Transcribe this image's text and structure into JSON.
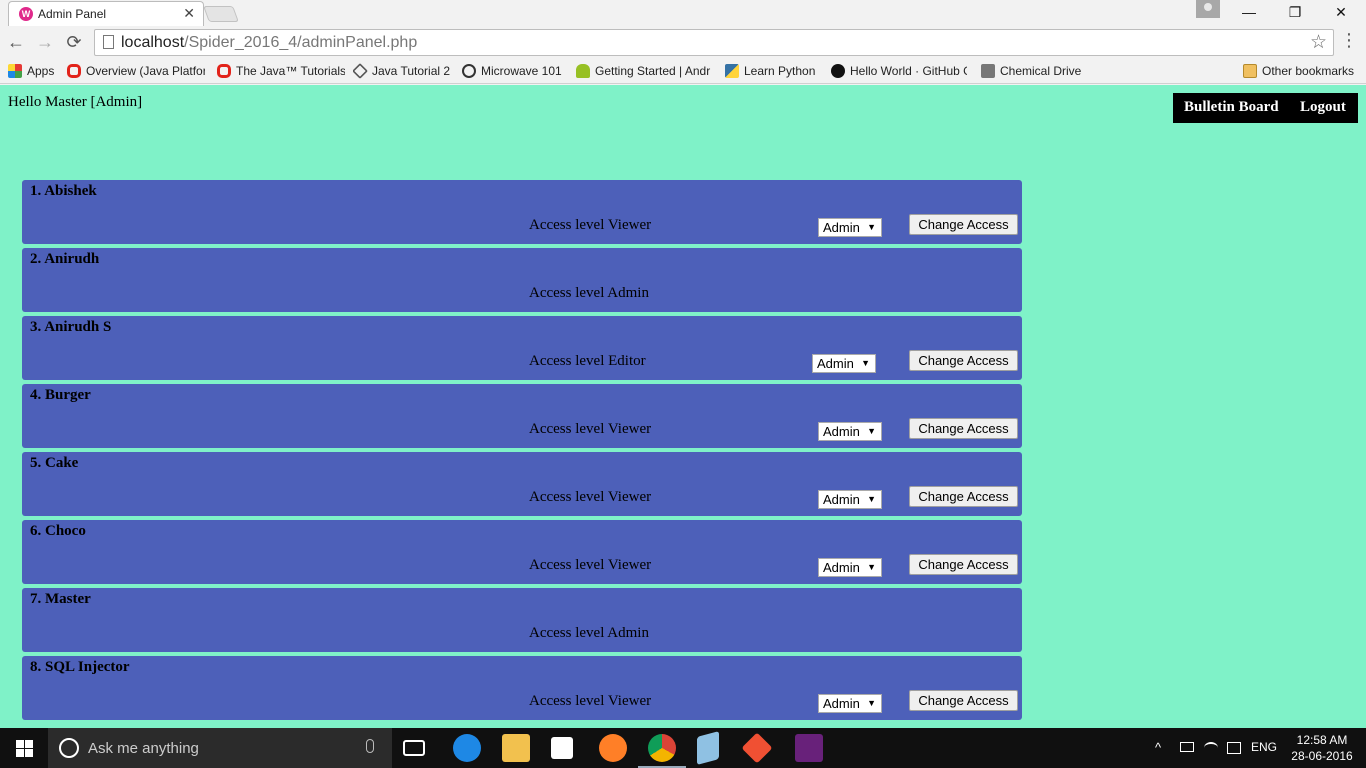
{
  "browser": {
    "tab": {
      "favicon": "W",
      "title": "Admin Panel",
      "close": "✕"
    },
    "window_buttons": {
      "minimize": "—",
      "restore": "❐",
      "close": "✕"
    },
    "nav": {
      "back": "←",
      "forward": "→",
      "reload": "⟳"
    },
    "url": {
      "host": "localhost",
      "path": "/Spider_2016_4/adminPanel.php"
    },
    "star": "☆",
    "menu": "⋮",
    "bookmarks": [
      {
        "label": "Apps",
        "icon": "apps-grid-icon",
        "color": "#e53935"
      },
      {
        "label": "Overview (Java Platfor",
        "icon": "oracle-icon",
        "color": "#e2231a"
      },
      {
        "label": "The Java™ Tutorials",
        "icon": "oracle-icon",
        "color": "#e2231a"
      },
      {
        "label": "Java Tutorial 2",
        "icon": "diamond-icon",
        "color": "#555555"
      },
      {
        "label": "Microwave 101",
        "icon": "globe-icon",
        "color": "#333333"
      },
      {
        "label": "Getting Started | Andr",
        "icon": "android-icon",
        "color": "#97c024"
      },
      {
        "label": "Learn Python",
        "icon": "python-icon",
        "color": "#3572a5"
      },
      {
        "label": "Hello World · GitHub G",
        "icon": "github-icon",
        "color": "#111111"
      },
      {
        "label": "Chemical Drive",
        "icon": "drive-icon",
        "color": "#777777"
      }
    ],
    "other_bookmarks": "Other bookmarks"
  },
  "page": {
    "greeting": "Hello Master [Admin]",
    "nav": {
      "bulletin": "Bulletin Board",
      "logout": "Logout"
    },
    "change_access_label": "Change Access",
    "users": [
      {
        "num": "1.",
        "name": "Abishek",
        "access": "Access level Viewer",
        "select": "Admin",
        "editable": true
      },
      {
        "num": "2.",
        "name": "Anirudh",
        "access": "Access level Admin",
        "select": "",
        "editable": false
      },
      {
        "num": "3.",
        "name": "Anirudh S",
        "access": "Access level Editor",
        "select": "Admin",
        "editable": true
      },
      {
        "num": "4.",
        "name": "Burger",
        "access": "Access level Viewer",
        "select": "Admin",
        "editable": true
      },
      {
        "num": "5.",
        "name": "Cake",
        "access": "Access level Viewer",
        "select": "Admin",
        "editable": true
      },
      {
        "num": "6.",
        "name": "Choco",
        "access": "Access level Viewer",
        "select": "Admin",
        "editable": true
      },
      {
        "num": "7.",
        "name": "Master",
        "access": "Access level Admin",
        "select": "",
        "editable": false
      },
      {
        "num": "8.",
        "name": "SQL Injector",
        "access": "Access level Viewer",
        "select": "Admin",
        "editable": true
      }
    ]
  },
  "taskbar": {
    "search_placeholder": "Ask me anything",
    "language": "ENG",
    "time": "12:58 AM",
    "date": "28-06-2016",
    "pinned": [
      {
        "name": "task-view-icon",
        "color": "#ffffff"
      },
      {
        "name": "edge-icon",
        "color": "#1e88e5"
      },
      {
        "name": "file-explorer-icon",
        "color": "#f2c14e"
      },
      {
        "name": "store-icon",
        "color": "#ffffff"
      },
      {
        "name": "firefox-icon",
        "color": "#ff7f27"
      },
      {
        "name": "chrome-icon",
        "color": "#4caf50"
      },
      {
        "name": "notepad-icon",
        "color": "#8fc1e3"
      },
      {
        "name": "git-icon",
        "color": "#f05033"
      },
      {
        "name": "visual-studio-icon",
        "color": "#68217a"
      }
    ]
  }
}
